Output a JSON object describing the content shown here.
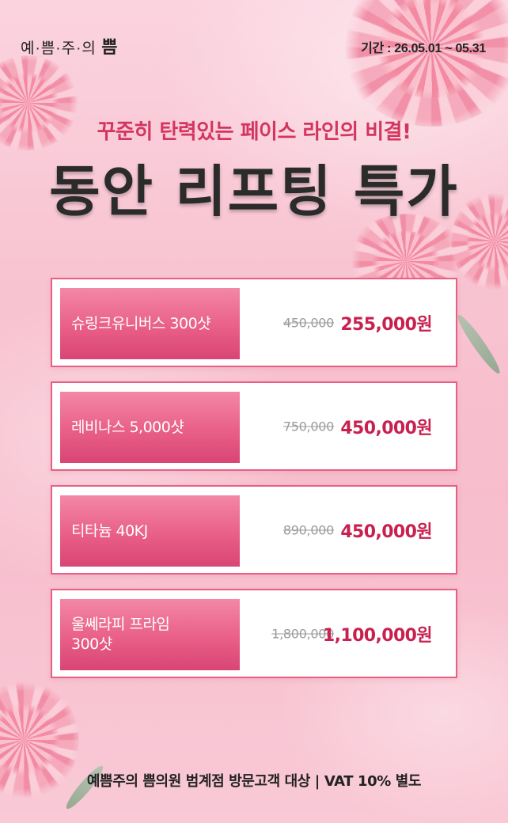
{
  "header": {
    "logo_text": "예·쁨·주·의",
    "logo_strong": "쁨",
    "period": "기간 : 26.05.01 ~ 05.31"
  },
  "hero": {
    "subtitle": "꾸준히 탄력있는 페이스 라인의 비결!",
    "title": "동안 리프팅 특가"
  },
  "items": [
    {
      "name": "슈링크유니버스 300샷",
      "original_price": "450,000",
      "sale_price": "255,000원"
    },
    {
      "name": "레비나스 5,000샷",
      "original_price": "750,000",
      "sale_price": "450,000원"
    },
    {
      "name": "티타늄 40KJ",
      "original_price": "890,000",
      "sale_price": "450,000원"
    },
    {
      "name": "울쎄라피 프라임\n300샷",
      "original_price": "1,800,000",
      "sale_price": "1,100,000원"
    }
  ],
  "footer": {
    "note": "예쁨주의 쁨의원 범계점 방문고객 대상 | VAT 10% 별도"
  },
  "colors": {
    "accent": "#e95f88",
    "sale": "#c8214f",
    "background": "#f8c3d1"
  },
  "icons": [
    "carnation-flower-icon"
  ]
}
